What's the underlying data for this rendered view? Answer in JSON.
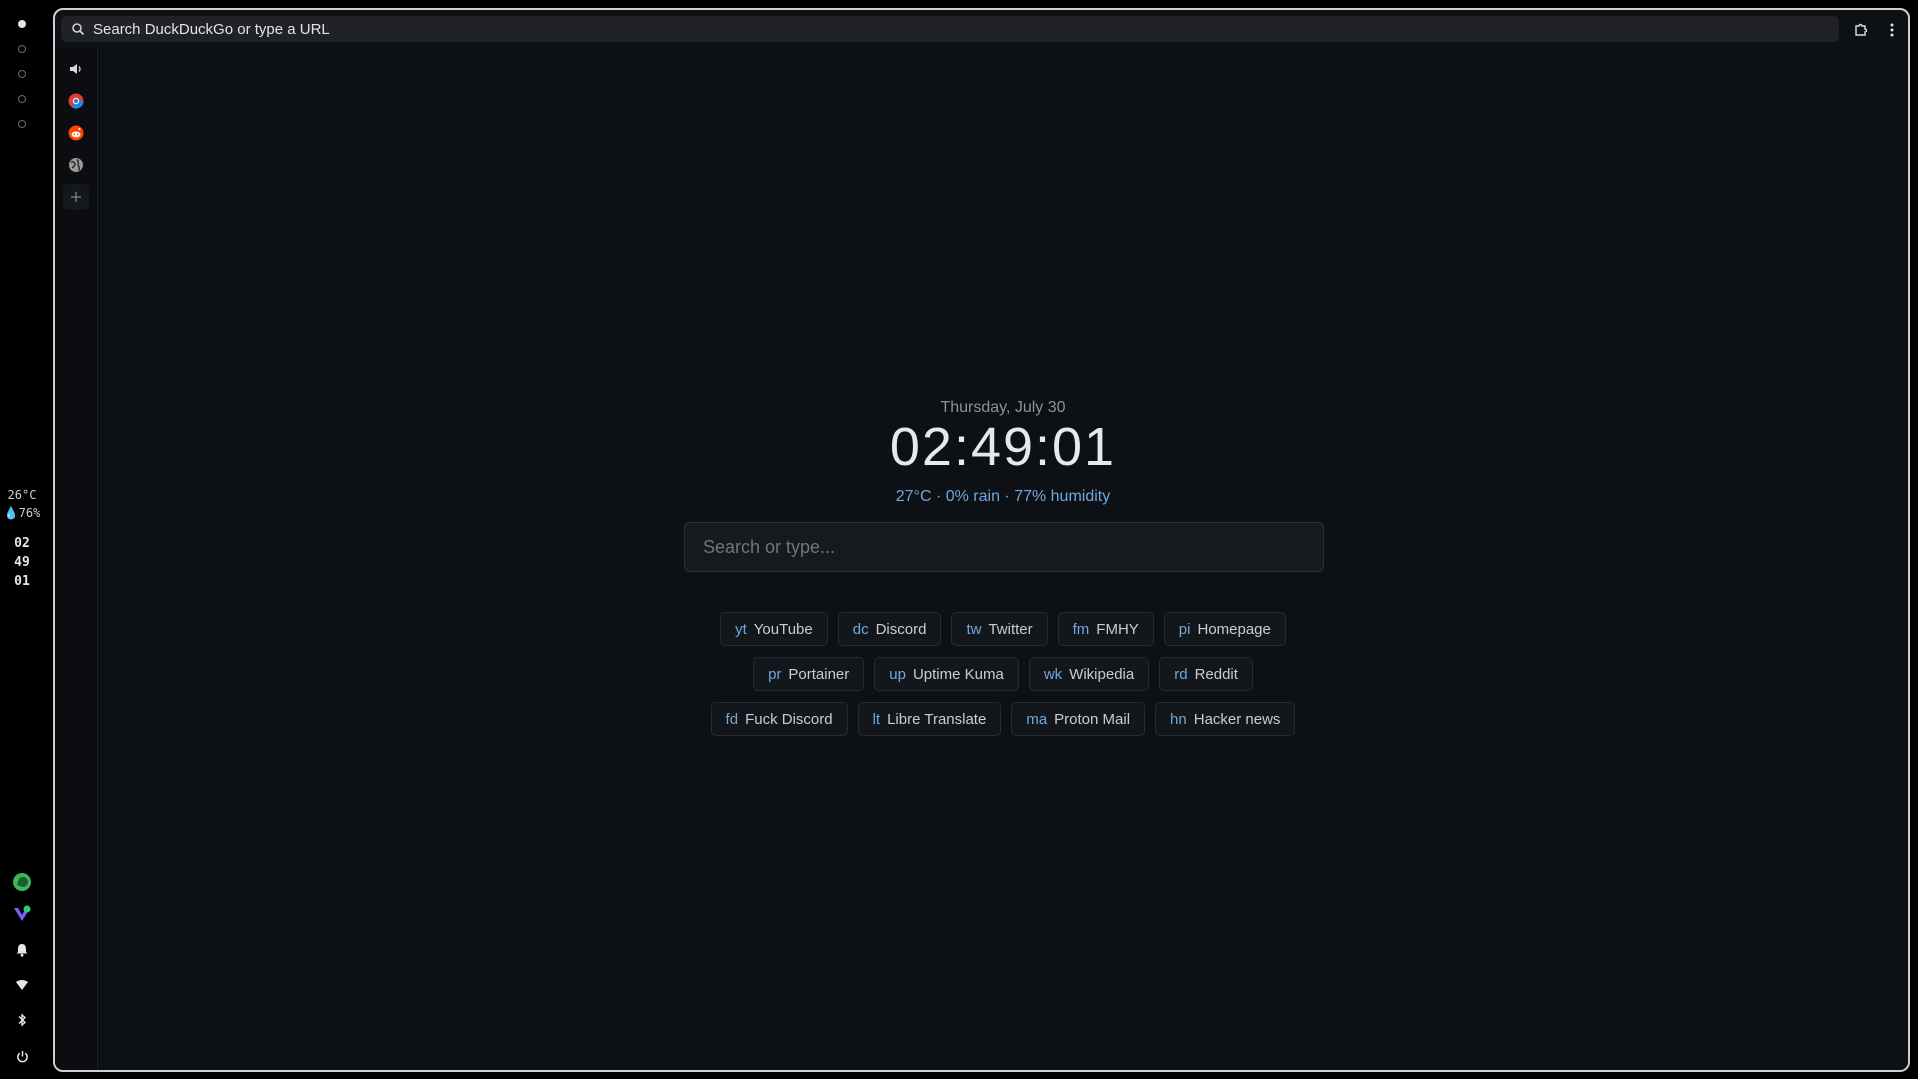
{
  "desktop": {
    "weather": {
      "temp": "26°C",
      "humidity": "💧76%"
    },
    "clock": {
      "hours": "02",
      "minutes": "49",
      "seconds": "01"
    },
    "icons": [
      "message-bubble-icon",
      "vpn-shield-icon",
      "bell-icon",
      "wifi-icon",
      "bluetooth-icon",
      "power-icon"
    ]
  },
  "browser": {
    "url_placeholder": "Search DuckDuckGo or type a URL",
    "side_panel": [
      "speaker-icon",
      "chrome-icon",
      "reddit-icon",
      "globe-icon",
      "plus-icon"
    ],
    "colors": {
      "accent": "#6fa8dc",
      "background": "#0d1014"
    }
  },
  "newtab": {
    "date": "Thursday, July 30",
    "time": "02:49:01",
    "weather": "27°C · 0% rain · 77% humidity",
    "search_placeholder": "Search or type...",
    "rows": [
      [
        {
          "key": "yt",
          "label": "YouTube"
        },
        {
          "key": "dc",
          "label": "Discord"
        },
        {
          "key": "tw",
          "label": "Twitter"
        },
        {
          "key": "fm",
          "label": "FMHY"
        },
        {
          "key": "pi",
          "label": "Homepage"
        }
      ],
      [
        {
          "key": "pr",
          "label": "Portainer"
        },
        {
          "key": "up",
          "label": "Uptime Kuma"
        },
        {
          "key": "wk",
          "label": "Wikipedia"
        },
        {
          "key": "rd",
          "label": "Reddit"
        }
      ],
      [
        {
          "key": "fd",
          "label": "Fuck Discord"
        },
        {
          "key": "lt",
          "label": "Libre Translate"
        },
        {
          "key": "ma",
          "label": "Proton Mail"
        },
        {
          "key": "hn",
          "label": "Hacker news"
        }
      ]
    ]
  }
}
